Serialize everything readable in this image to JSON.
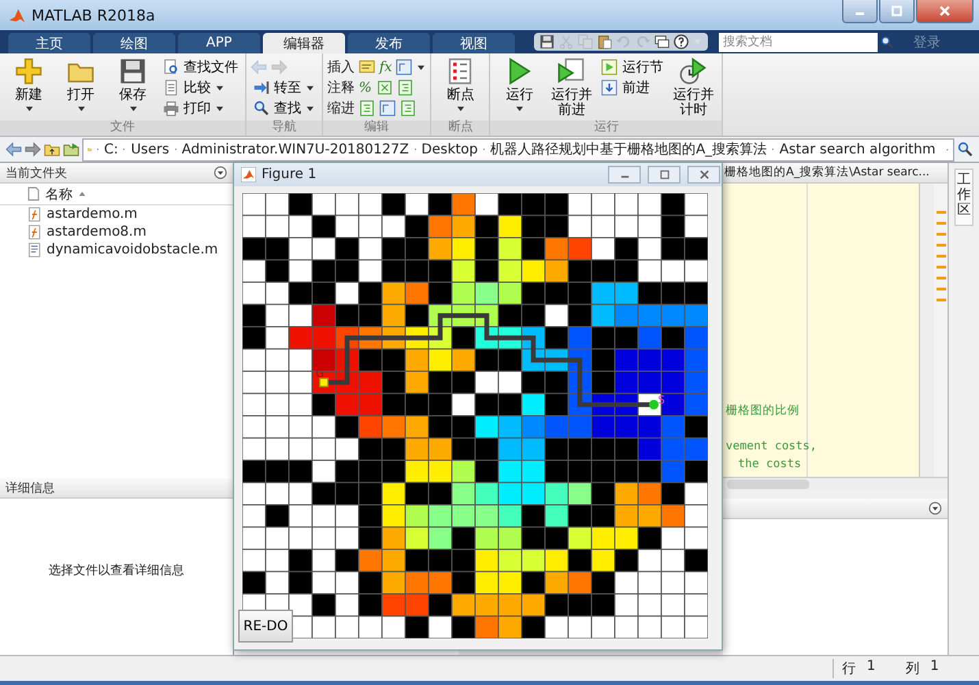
{
  "window": {
    "title": "MATLAB R2018a"
  },
  "tabs": [
    {
      "label": "主页",
      "selected": false
    },
    {
      "label": "绘图",
      "selected": false
    },
    {
      "label": "APP",
      "selected": false
    },
    {
      "label": "编辑器",
      "selected": true
    },
    {
      "label": "发布",
      "selected": false
    },
    {
      "label": "视图",
      "selected": false
    }
  ],
  "quick_access": [
    {
      "disabled": false
    },
    {
      "disabled": true
    },
    {
      "disabled": true
    },
    {
      "disabled": false
    },
    {
      "disabled": true
    },
    {
      "disabled": true
    },
    {
      "disabled": false
    },
    {
      "disabled": false
    }
  ],
  "search": {
    "placeholder": "搜索文档"
  },
  "login": "登录",
  "ribbon": [
    {
      "label": "文件",
      "items": [
        {
          "kind": "large",
          "label": "新建",
          "dropdown": true
        },
        {
          "kind": "large",
          "label": "打开",
          "dropdown": true
        },
        {
          "kind": "large",
          "label": "保存",
          "dropdown": true
        },
        {
          "kind": "stack",
          "rows": [
            {
              "kind": "button",
              "label": "查找文件",
              "dropdown": false
            },
            {
              "kind": "button",
              "label": "比较",
              "dropdown": true
            },
            {
              "kind": "button",
              "label": "打印",
              "dropdown": true
            }
          ]
        }
      ]
    },
    {
      "label": "导航",
      "items": [
        {
          "kind": "stack",
          "rows": [
            {
              "kind": "arrows",
              "disabled": true
            },
            {
              "kind": "button",
              "label": "转至",
              "dropdown": true
            },
            {
              "kind": "button",
              "label": "查找",
              "dropdown": true
            }
          ]
        }
      ]
    },
    {
      "label": "编辑",
      "items": [
        {
          "kind": "stack",
          "rows": [
            {
              "kind": "tools",
              "label": "插入",
              "dropdown": true,
              "parts": [
                {
                  "kind": "icon"
                },
                {
                  "kind": "glyph",
                  "text": "fx"
                },
                {
                  "kind": "icon"
                }
              ]
            },
            {
              "kind": "tools",
              "label": "注释",
              "dropdown": false,
              "parts": [
                {
                  "kind": "glyph",
                  "text": "%"
                },
                {
                  "kind": "icon"
                },
                {
                  "kind": "icon"
                }
              ]
            },
            {
              "kind": "tools",
              "label": "缩进",
              "dropdown": false,
              "parts": [
                {
                  "kind": "icon"
                },
                {
                  "kind": "icon"
                },
                {
                  "kind": "icon"
                }
              ]
            }
          ]
        }
      ]
    },
    {
      "label": "断点",
      "items": [
        {
          "kind": "large",
          "label": "断点",
          "dropdown": true
        }
      ]
    },
    {
      "label": "运行",
      "items": [
        {
          "kind": "large",
          "label": "运行",
          "dropdown": true
        },
        {
          "kind": "large",
          "label": "运行并前进",
          "dropdown": false
        },
        {
          "kind": "stack",
          "rows": [
            {
              "kind": "button",
              "label": "运行节",
              "dropdown": false
            },
            {
              "kind": "button",
              "label": "前进",
              "dropdown": false
            }
          ]
        },
        {
          "kind": "large",
          "label": "运行并计时",
          "dropdown": false
        }
      ]
    }
  ],
  "address": {
    "crumbs": [
      "C:",
      "Users",
      "Administrator.WIN7U-20180127Z",
      "Desktop",
      "机器人路径规划中基于栅格地图的A_搜索算法",
      "Astar search algorithm"
    ]
  },
  "current_folder": {
    "title": "当前文件夹",
    "column": "名称",
    "files": [
      {
        "name": "astardemo.m",
        "kind": "function"
      },
      {
        "name": "astardemo8.m",
        "kind": "function"
      },
      {
        "name": "dynamicavoidobstacle.m",
        "kind": "script"
      }
    ]
  },
  "details": {
    "title": "详细信息",
    "message": "选择文件以查看详细信息"
  },
  "editor": {
    "tab_title": "栅格地图的A_搜索算法\\Astar searc...",
    "lines": [
      {
        "text": "栅格图的比例",
        "indented": false
      },
      {
        "text": "vement costs,",
        "indented": false
      },
      {
        "text": "the costs",
        "indented": true
      }
    ]
  },
  "workspace_tab": "工作区",
  "figure": {
    "title": "Figure 1",
    "redo_button": "RE-DO",
    "start_label": "S",
    "goal_label": "G"
  },
  "status": {
    "row_label": "行",
    "row": "1",
    "col_label": "列",
    "col": "1"
  }
}
